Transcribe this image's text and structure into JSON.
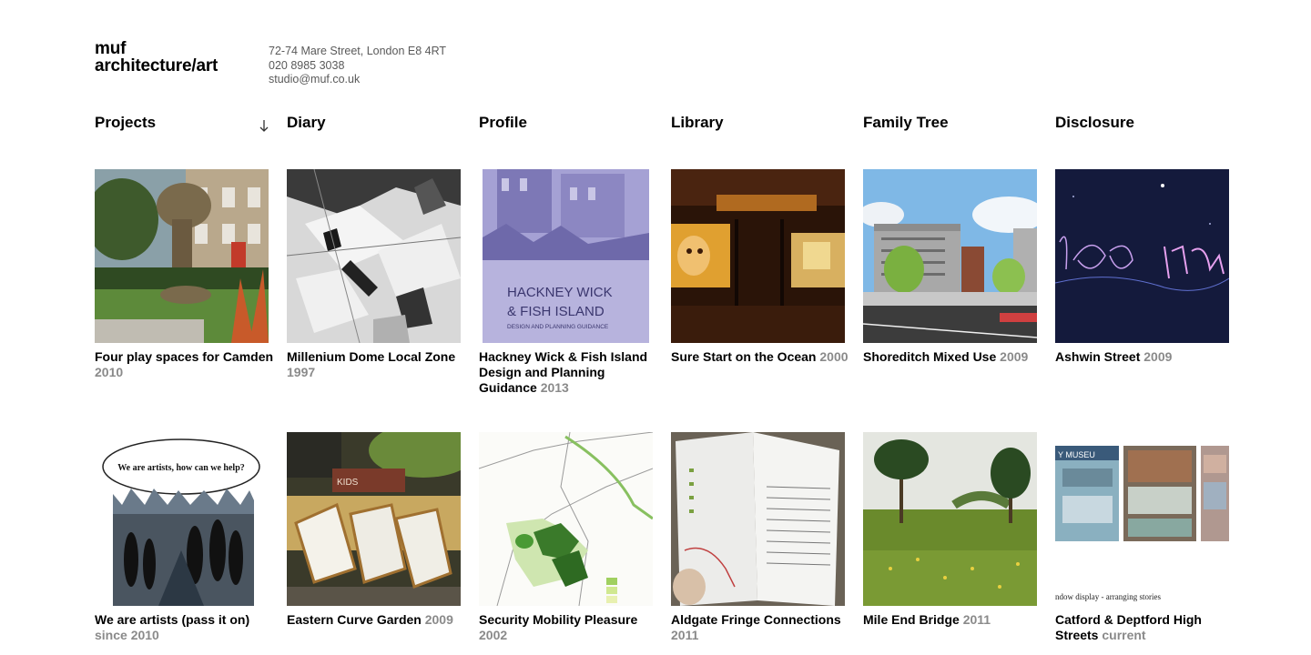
{
  "header": {
    "logo_line1": "muf",
    "logo_line2": "architecture/art",
    "address_line": "72-74 Mare Street, London E8 4RT",
    "phone": "020 8985 3038",
    "email": "studio@muf.co.uk"
  },
  "nav": {
    "projects": "Projects",
    "diary": "Diary",
    "profile": "Profile",
    "library": "Library",
    "family_tree": "Family Tree",
    "disclosure": "Disclosure",
    "sort_icon": "arrow-down-icon"
  },
  "projects": [
    {
      "title": "Four play spaces for Camden",
      "year": "2010"
    },
    {
      "title": "Millenium Dome Local Zone",
      "year": "1997"
    },
    {
      "title": "Hackney Wick & Fish Island Design and Planning Guidance",
      "year": "2013",
      "image_text_1": "HACKNEY WICK",
      "image_text_2": "& FISH ISLAND",
      "image_text_3": "DESIGN AND PLANNING GUIDANCE"
    },
    {
      "title": "Sure Start on the Ocean",
      "year": "2000"
    },
    {
      "title": "Shoreditch Mixed Use",
      "year": "2009"
    },
    {
      "title": "Ashwin Street",
      "year": "2009"
    },
    {
      "title": "We are artists (pass it on)",
      "year": "since 2010",
      "image_text": "We are artists, how can we help?"
    },
    {
      "title": "Eastern Curve Garden",
      "year": "2009",
      "image_text": "KIDS"
    },
    {
      "title": "Security Mobility Pleasure",
      "year": "2002"
    },
    {
      "title": "Aldgate Fringe Connections",
      "year": "2011"
    },
    {
      "title": "Mile End Bridge",
      "year": "2011"
    },
    {
      "title": "Catford & Deptford High Streets",
      "year": "current",
      "image_text": "ndow display - arranging stories",
      "image_text_2": "Y MUSEU"
    }
  ]
}
